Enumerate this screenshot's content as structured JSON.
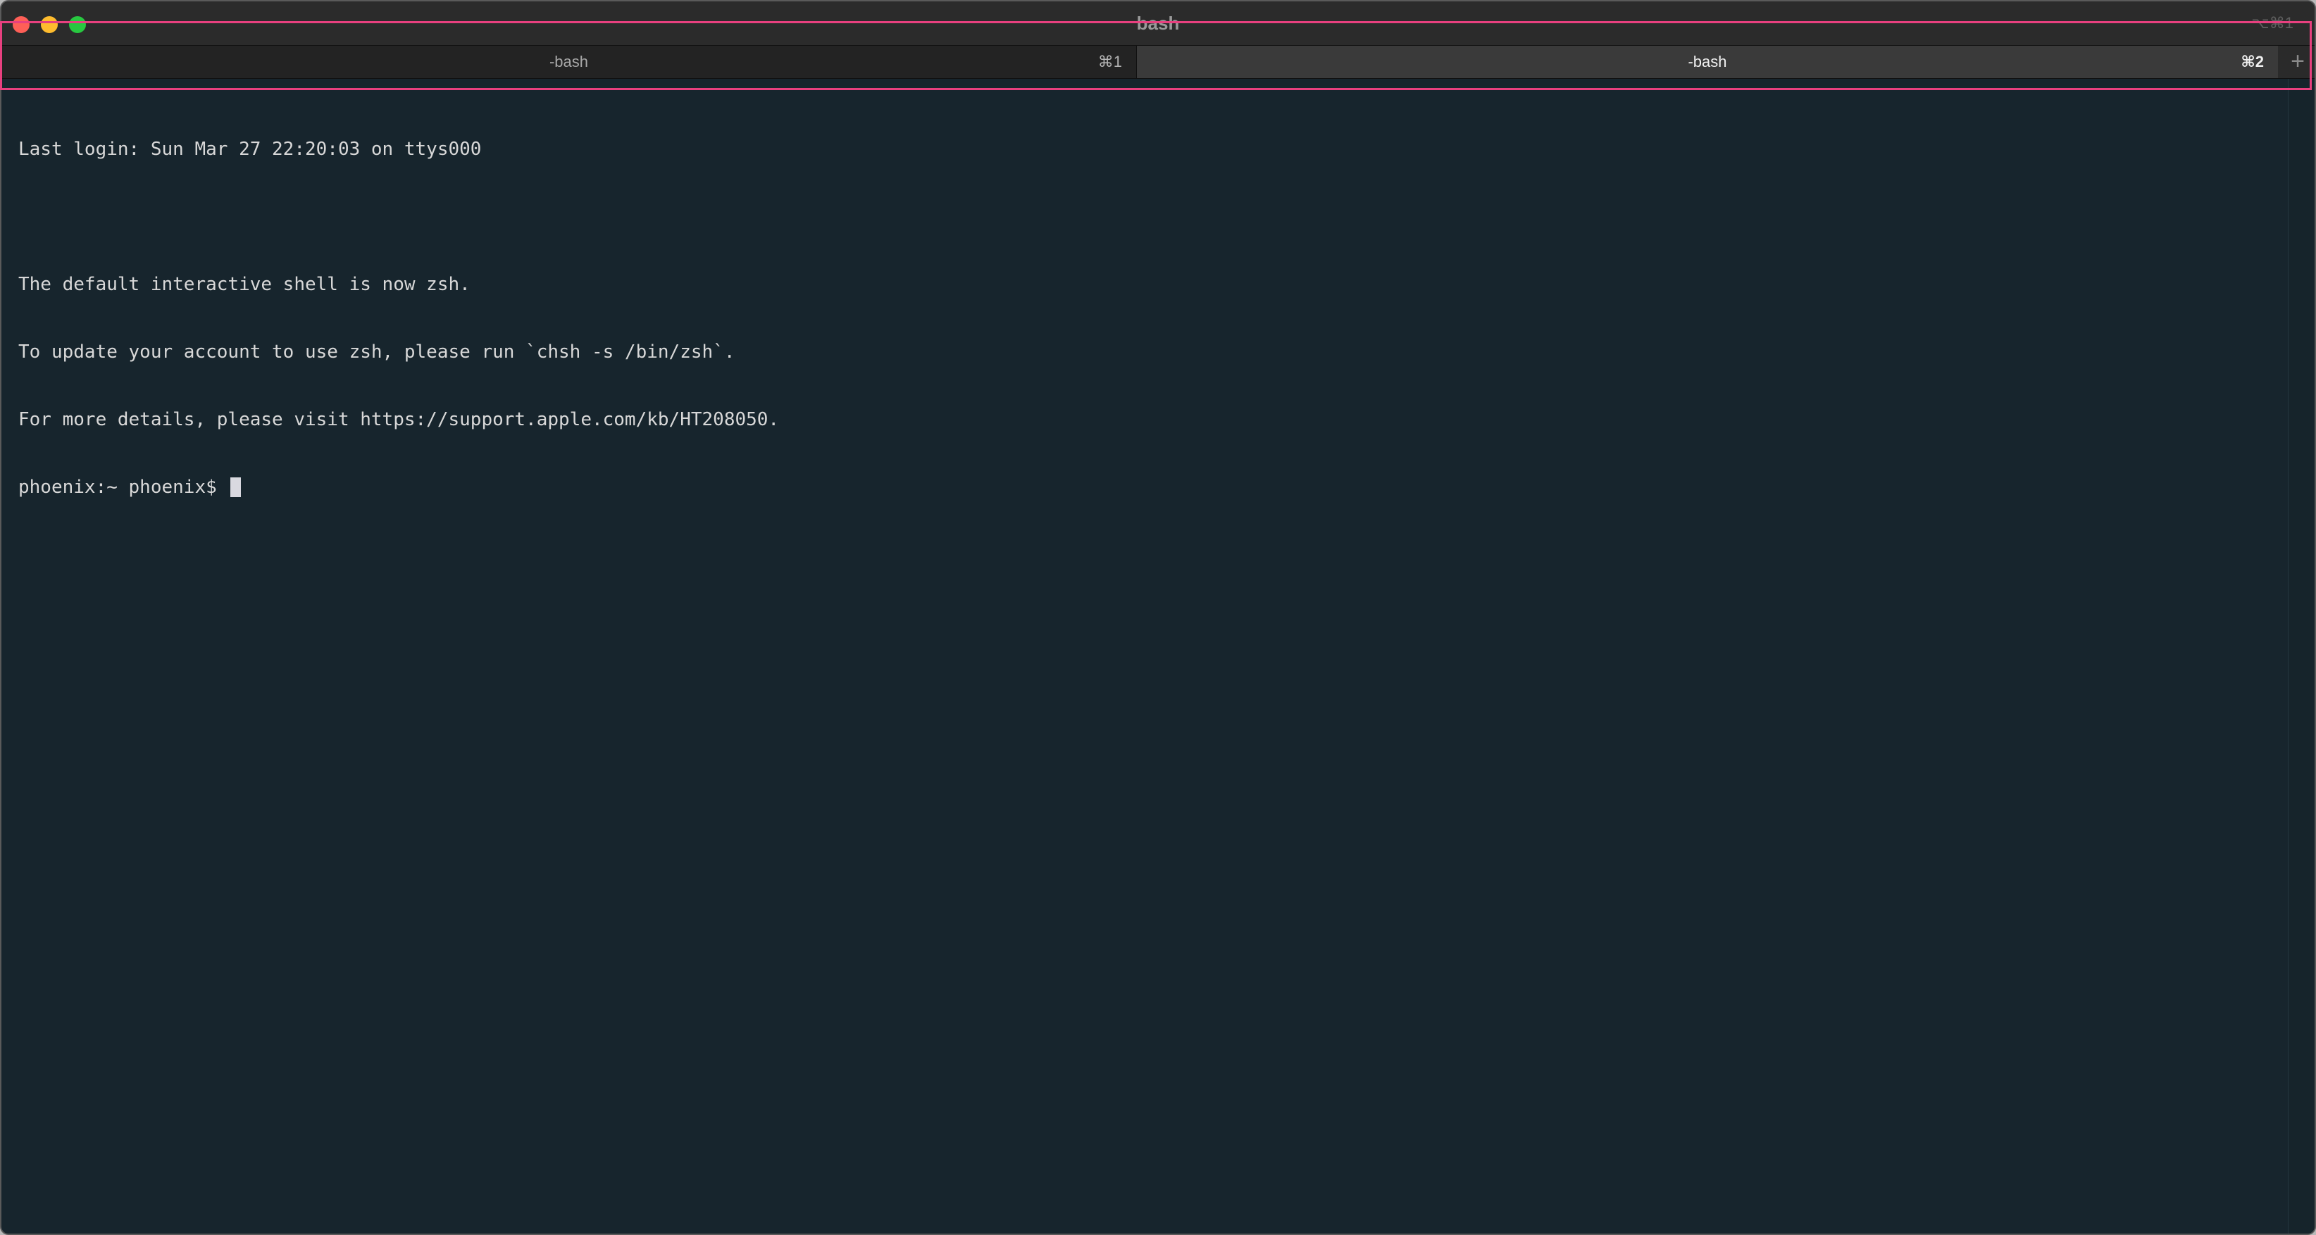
{
  "window": {
    "title": "bash",
    "title_shortcut": "⌥⌘1"
  },
  "tabs": [
    {
      "label": "-bash",
      "shortcut": "⌘1",
      "active": false
    },
    {
      "label": "-bash",
      "shortcut": "⌘2",
      "active": true
    }
  ],
  "new_tab_icon": "plus-icon",
  "new_tab_glyph": "+",
  "terminal": {
    "lines": [
      "Last login: Sun Mar 27 22:20:03 on ttys000",
      "",
      "The default interactive shell is now zsh.",
      "To update your account to use zsh, please run `chsh -s /bin/zsh`.",
      "For more details, please visit https://support.apple.com/kb/HT208050."
    ],
    "prompt": "phoenix:~ phoenix$ "
  },
  "colors": {
    "terminal_bg": "#17252d",
    "terminal_fg": "#d8d8d8",
    "highlight": "#e8407f",
    "close": "#fe5f57",
    "minimize": "#febc2e",
    "maximize": "#28c840"
  }
}
